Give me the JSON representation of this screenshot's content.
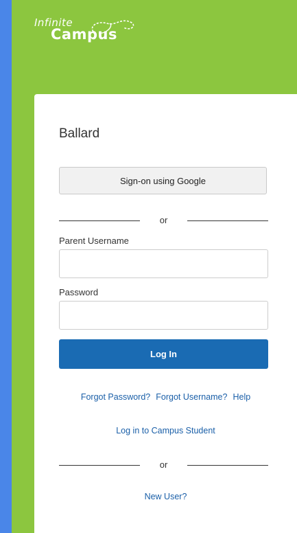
{
  "logo": {
    "line1": "Infinite",
    "line2": "Campus"
  },
  "district": "Ballard",
  "google_button": "Sign-on using Google",
  "divider_text": "or",
  "username": {
    "label": "Parent Username",
    "value": "",
    "placeholder": ""
  },
  "password": {
    "label": "Password",
    "value": "",
    "placeholder": ""
  },
  "login_button": "Log In",
  "links": {
    "forgot_password": "Forgot Password?",
    "forgot_username": "Forgot Username?",
    "help": "Help",
    "campus_student": "Log in to Campus Student",
    "new_user": "New User?"
  },
  "colors": {
    "background_blue": "#4a86e8",
    "brand_green": "#8cc63f",
    "primary_button": "#1a6bb3",
    "link": "#1a5fa8"
  }
}
